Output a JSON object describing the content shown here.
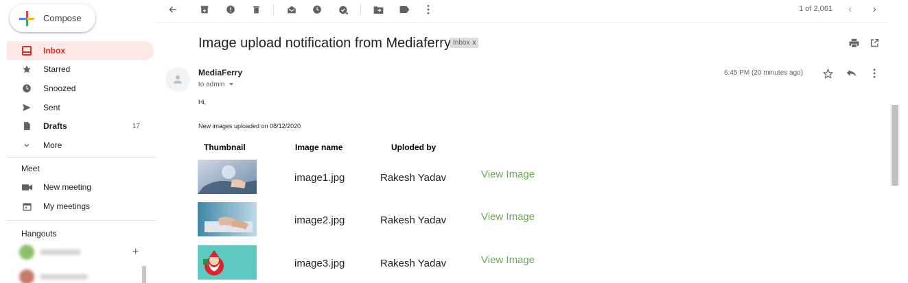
{
  "sidebar": {
    "compose_label": "Compose",
    "nav": [
      {
        "label": "Inbox",
        "icon": "inbox-icon"
      },
      {
        "label": "Starred",
        "icon": "star-icon"
      },
      {
        "label": "Snoozed",
        "icon": "clock-icon"
      },
      {
        "label": "Sent",
        "icon": "send-icon"
      },
      {
        "label": "Drafts",
        "icon": "draft-icon",
        "count": "17"
      },
      {
        "label": "More",
        "icon": "chevron-down-icon"
      }
    ],
    "meet": {
      "title": "Meet",
      "new_meeting": "New meeting",
      "my_meetings": "My meetings"
    },
    "hangouts": {
      "title": "Hangouts"
    }
  },
  "toolbar": {
    "pager": "1 of 2,061"
  },
  "message": {
    "subject": "Image upload notification from Mediaferry",
    "label_chip": "Inbox",
    "label_chip_close": "x",
    "sender": "MediaFerry",
    "to_line": "to admin",
    "time": "6:45 PM (20 minutes ago)",
    "greeting": "Hi,",
    "intro": "New images uploaded on 08/12/2020",
    "table": {
      "headers": [
        "Thumbnail",
        "Image name",
        "Uploded by"
      ],
      "rows": [
        {
          "name": "image1.jpg",
          "uploader": "Rakesh Yadav",
          "link": "View Image"
        },
        {
          "name": "image2.jpg",
          "uploader": "Rakesh Yadav",
          "link": "View Image"
        },
        {
          "name": "image3.jpg",
          "uploader": "Rakesh Yadav",
          "link": "View Image"
        }
      ]
    }
  },
  "colors": {
    "inbox_active_bg": "#fce8e6",
    "inbox_active_text": "#d93025",
    "link_green": "#6aa84f"
  }
}
